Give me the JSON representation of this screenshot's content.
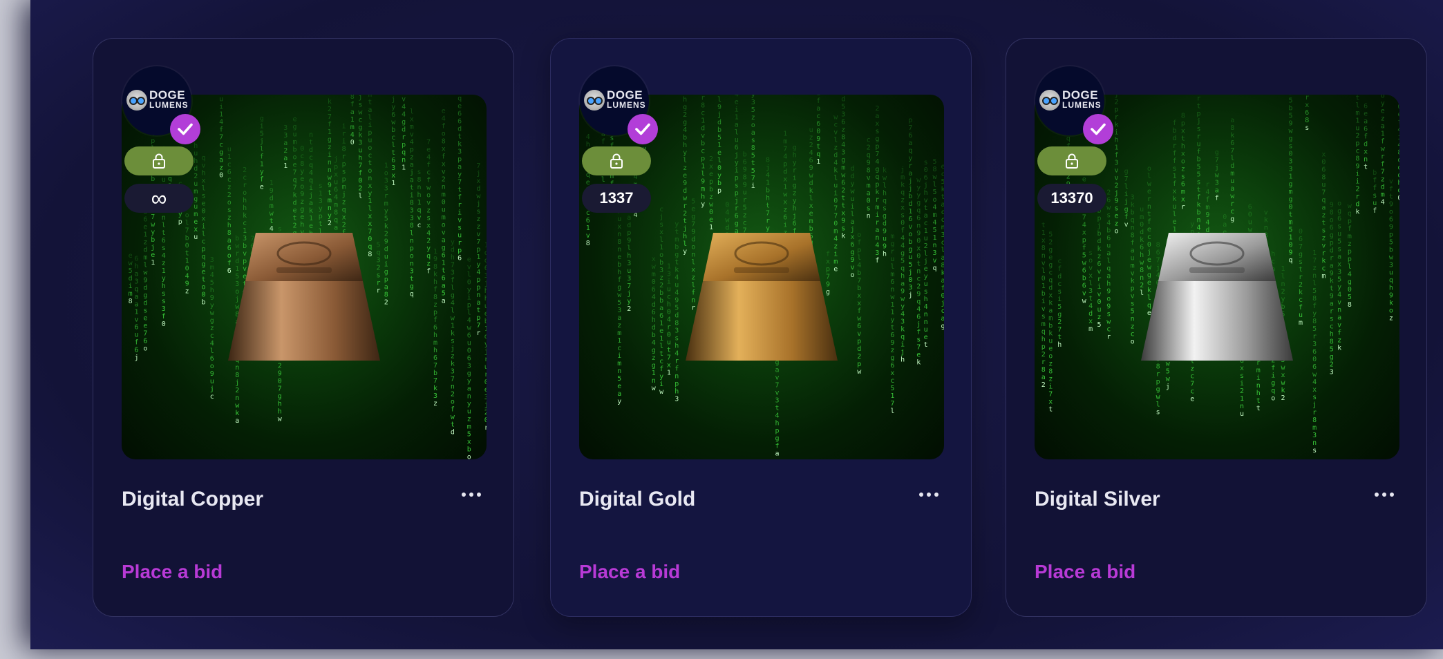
{
  "cards": [
    {
      "creator": {
        "logo_line1": "DOGE",
        "logo_line2": "LUMENS",
        "avatar_icon": "doge-avatar-icon",
        "verified_icon": "check-icon"
      },
      "lock_icon": "lock-icon",
      "edition": "∞",
      "title": "Digital Copper",
      "action_label": "Place a bid",
      "menu_icon": "more-icon",
      "metal": {
        "light": "#c9966a",
        "mid": "#8a5a36",
        "dark": "#3d2614"
      }
    },
    {
      "creator": {
        "logo_line1": "DOGE",
        "logo_line2": "LUMENS",
        "avatar_icon": "doge-avatar-icon",
        "verified_icon": "check-icon"
      },
      "lock_icon": "lock-icon",
      "edition": "1337",
      "title": "Digital Gold",
      "action_label": "Place a bid",
      "menu_icon": "more-icon",
      "metal": {
        "light": "#e3b05a",
        "mid": "#a8722a",
        "dark": "#4a3010"
      }
    },
    {
      "creator": {
        "logo_line1": "DOGE",
        "logo_line2": "LUMENS",
        "avatar_icon": "doge-avatar-icon",
        "verified_icon": "check-icon"
      },
      "lock_icon": "lock-icon",
      "edition": "13370",
      "title": "Digital Silver",
      "action_label": "Place a bid",
      "menu_icon": "more-icon",
      "metal": {
        "light": "#f2f2f2",
        "mid": "#9a9a9a",
        "dark": "#3c3c3c"
      }
    }
  ],
  "colors": {
    "accent": "#b83ad6",
    "verified": "#b23ed8",
    "lock_pill": "#6c8e3a",
    "card_bg": "#121236"
  }
}
